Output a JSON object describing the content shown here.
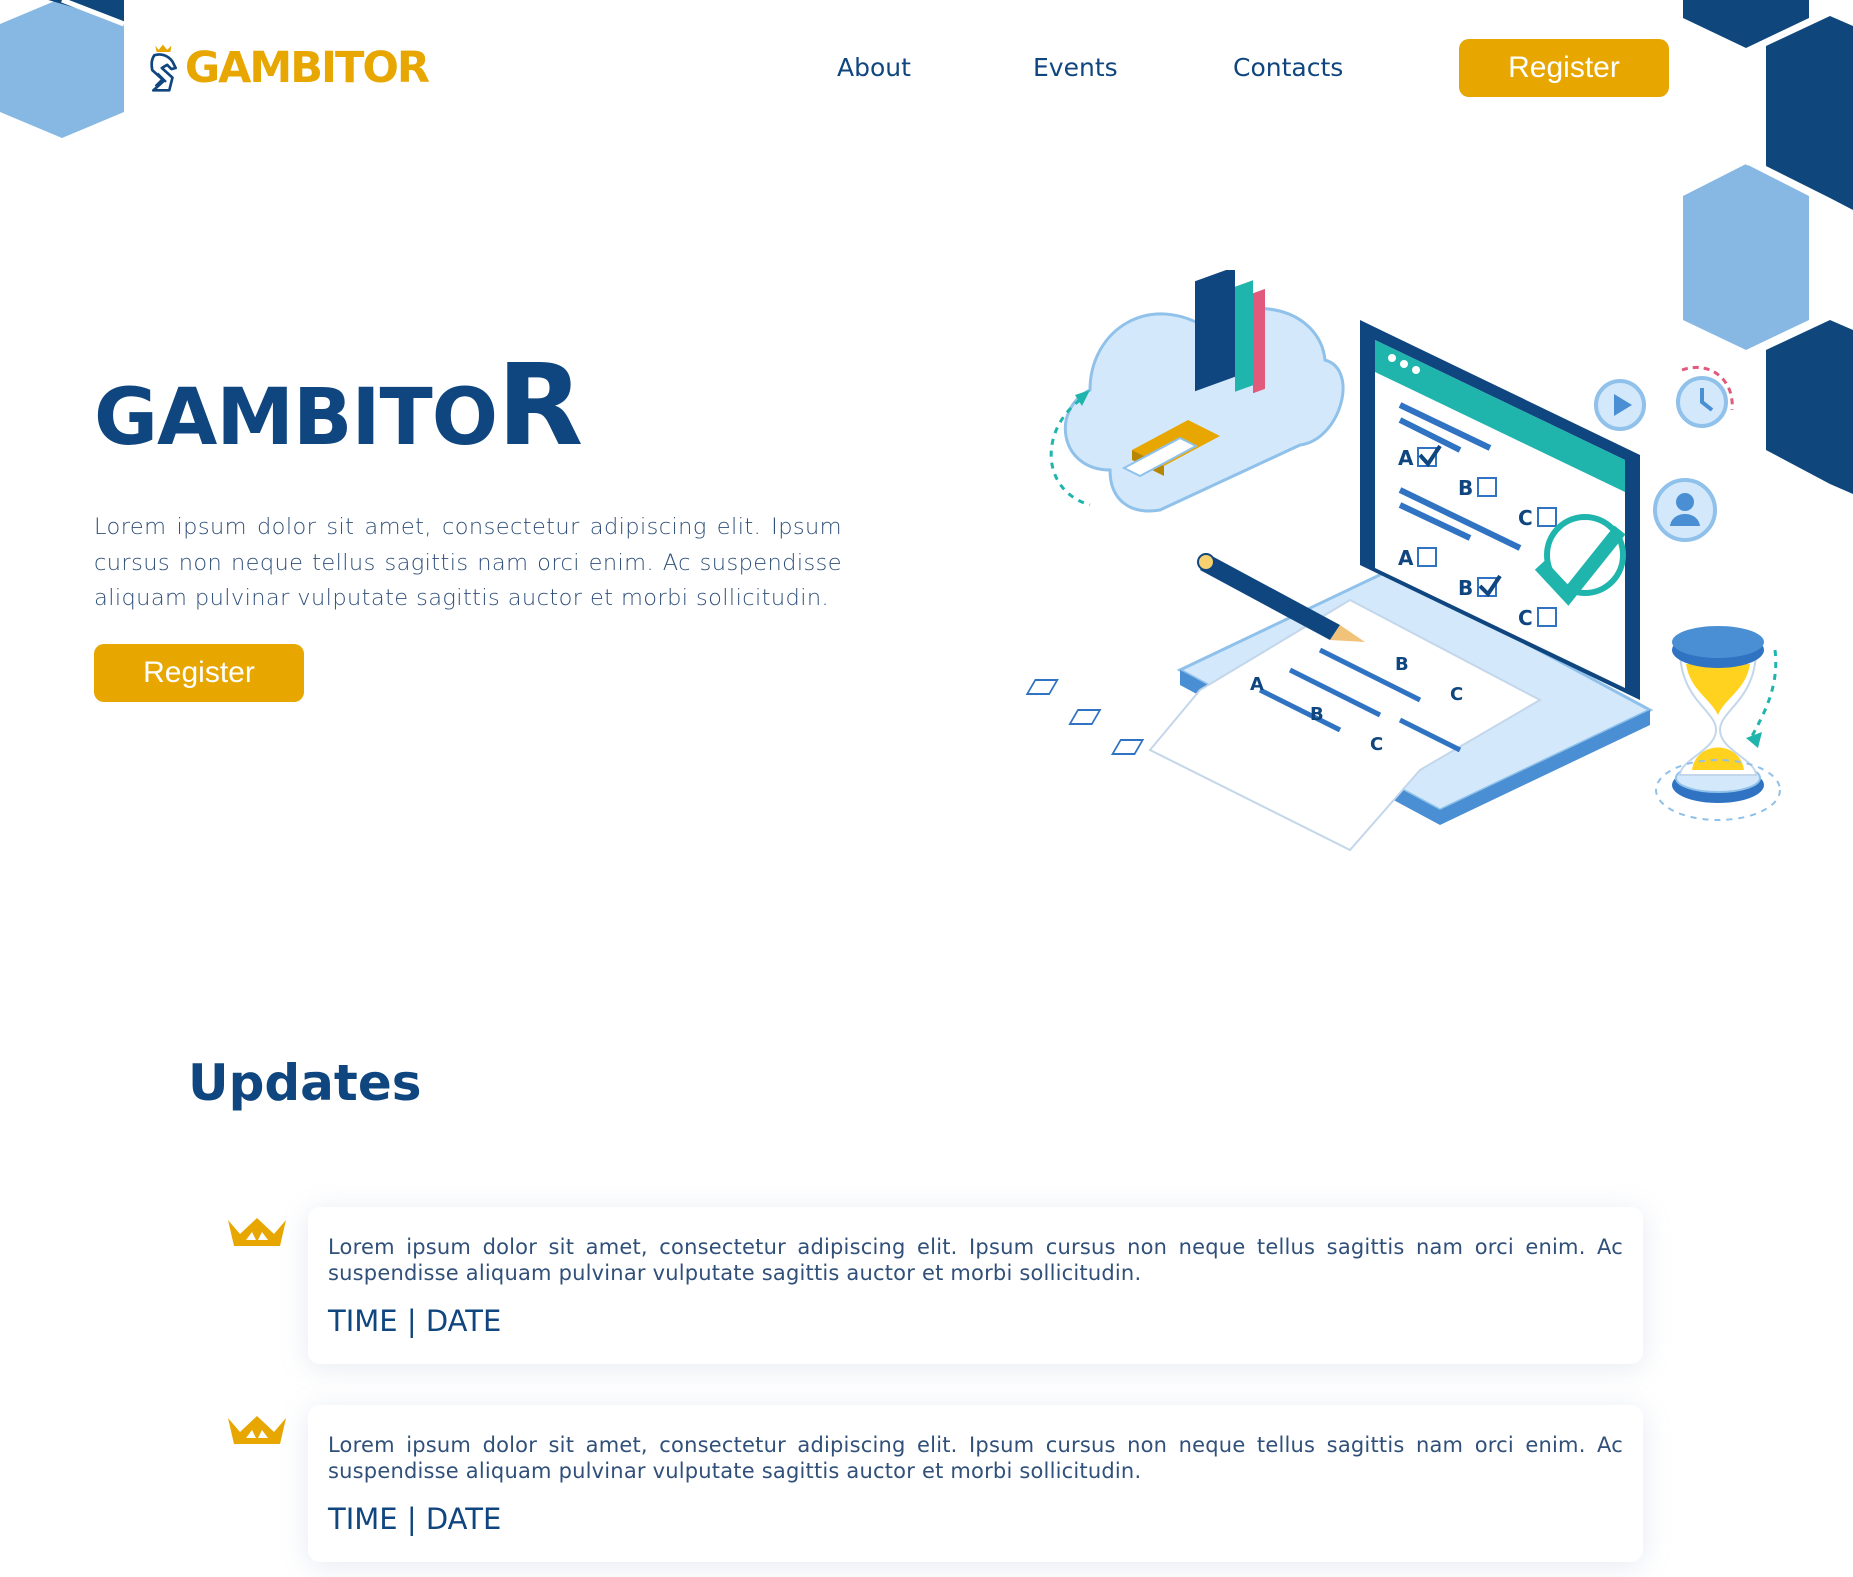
{
  "header": {
    "logo_text": "GAMBITOR",
    "nav": [
      {
        "label": "About"
      },
      {
        "label": "Events"
      },
      {
        "label": "Contacts"
      }
    ],
    "register_label": "Register"
  },
  "hero": {
    "title_main": "GAMBITO",
    "title_last": "R",
    "description": "Lorem ipsum dolor sit amet, consectetur adipiscing elit. Ipsum cursus non neque tellus sagittis nam orci enim. Ac suspendisse aliquam pulvinar vulputate sagittis auctor et morbi sollicitudin.",
    "register_label": "Register",
    "illustration_icon": "online-exam-illustration"
  },
  "updates": {
    "title": "Updates",
    "items": [
      {
        "text": "Lorem ipsum dolor sit amet, consectetur adipiscing elit. Ipsum cursus non neque tellus sagittis nam orci enim. Ac suspendisse aliquam pulvinar vulputate sagittis auctor et morbi sollicitudin.",
        "meta": "TIME | DATE",
        "icon": "crown-icon"
      },
      {
        "text": "Lorem ipsum dolor sit amet, consectetur adipiscing elit. Ipsum cursus non neque tellus sagittis nam orci enim. Ac suspendisse aliquam pulvinar vulputate sagittis auctor et morbi sollicitudin.",
        "meta": "TIME | DATE",
        "icon": "crown-icon"
      }
    ]
  },
  "colors": {
    "primary": "#10467f",
    "accent": "#e7a600",
    "hex_light": "#86b8e3",
    "hex_dark": "#0f477c",
    "teal": "#1fb5ad"
  }
}
